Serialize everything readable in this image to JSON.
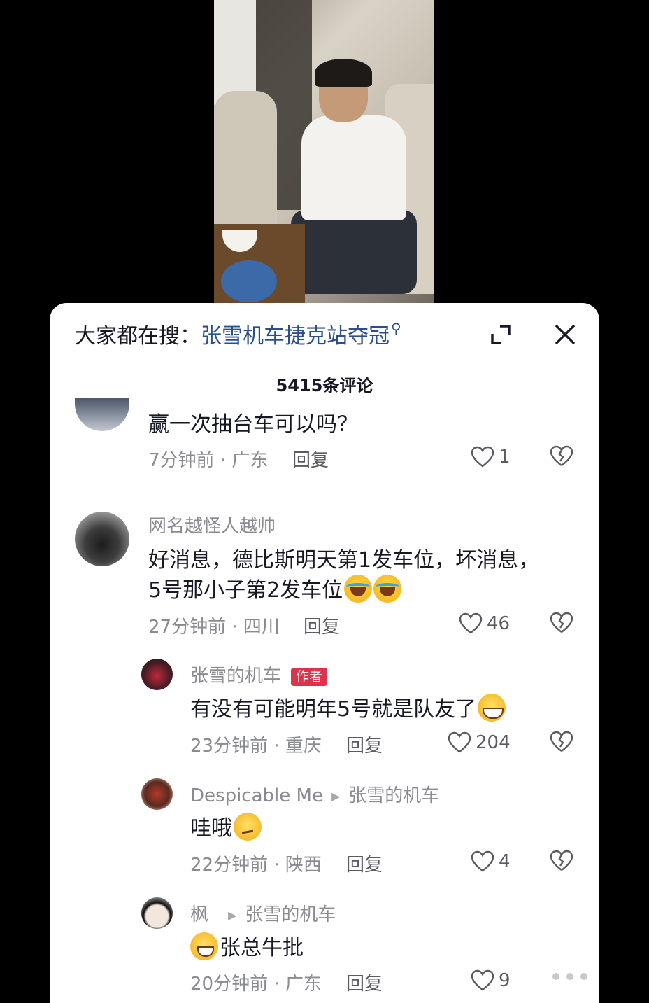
{
  "search": {
    "prefix": "大家都在搜：",
    "term": "张雪机车捷克站夺冠"
  },
  "comments_count": "5415条评论",
  "comments": [
    {
      "text": "赢一次抽台车可以吗？",
      "meta": "7分钟前 · 广东",
      "reply": "回复",
      "likes": "1"
    },
    {
      "name": "网名越怪人越帅",
      "text_line1": "好消息，德比斯明天第1发车位，坏消息，",
      "text_line2": "5号那小子第2发车位",
      "meta": "27分钟前 · 四川",
      "reply": "回复",
      "likes": "46"
    }
  ],
  "replies": [
    {
      "name": "张雪的机车",
      "badge": "作者",
      "text": "有没有可能明年5号就是队友了",
      "meta": "23分钟前 · 重庆",
      "reply": "回复",
      "likes": "204"
    },
    {
      "name": "Despicable Me",
      "reply_to": "张雪的机车",
      "text": "哇哦",
      "meta": "22分钟前 · 陕西",
      "reply": "回复",
      "likes": "4"
    },
    {
      "name": "枫",
      "reply_to": "张雪的机车",
      "text": "张总牛批",
      "meta": "20分钟前 · 广东",
      "reply": "回复",
      "likes": "9"
    }
  ],
  "colors": {
    "accent_link": "#2b4f8a",
    "author_badge": "#d9344b",
    "secondary_text": "#8a8b91"
  }
}
